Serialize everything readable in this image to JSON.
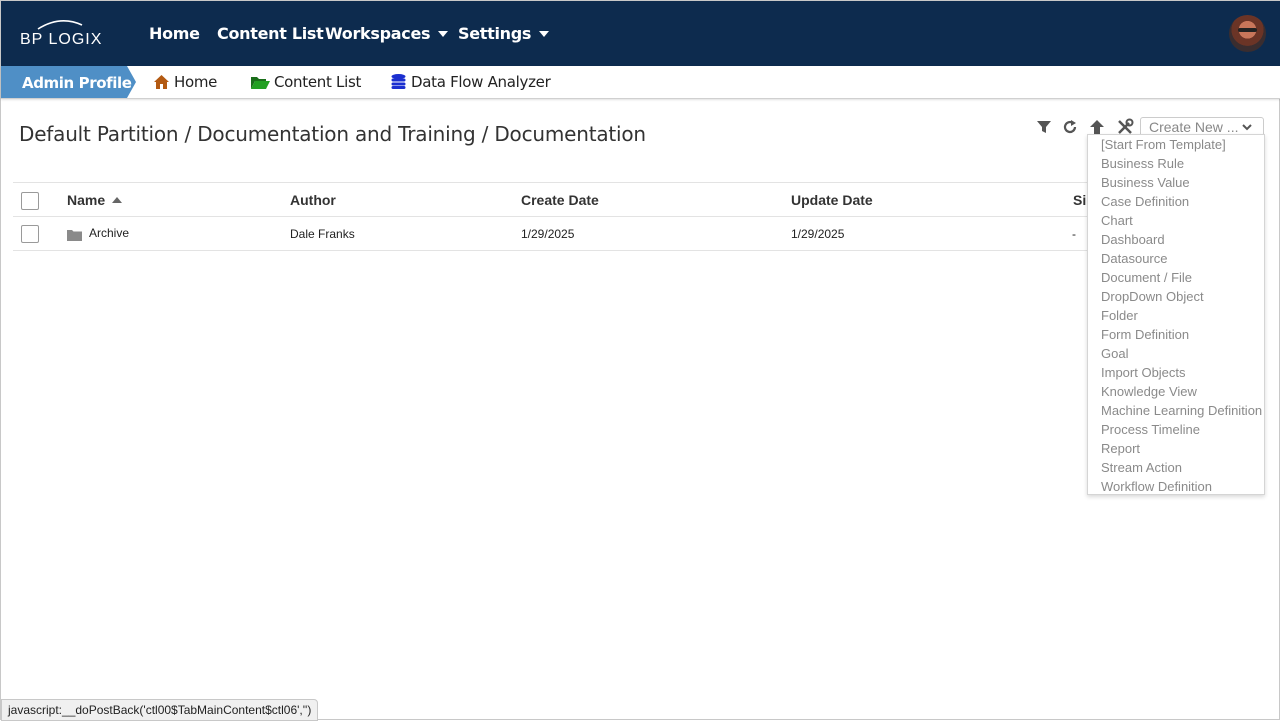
{
  "brand": {
    "logo_text": "BP LOGIX"
  },
  "topnav": {
    "items": [
      {
        "label": "Home",
        "has_caret": false
      },
      {
        "label": "Content List",
        "has_caret": false
      },
      {
        "label": "Workspaces",
        "has_caret": true
      },
      {
        "label": "Settings",
        "has_caret": true
      }
    ],
    "avatar": "user-avatar"
  },
  "tabbar": {
    "profile": "Admin Profile",
    "tabs": [
      {
        "label": "Home",
        "icon": "home-icon",
        "color": "#b35a12"
      },
      {
        "label": "Content List",
        "icon": "folder-open-icon",
        "color": "#1a8a1a"
      },
      {
        "label": "Data Flow Analyzer",
        "icon": "database-icon",
        "color": "#1b2fd0"
      }
    ]
  },
  "path": "Default Partition / Documentation and Training / Documentation",
  "toolbar": {
    "icons": [
      "filter-icon",
      "refresh-icon",
      "up-arrow-icon",
      "tools-icon"
    ],
    "create_new_label": "Create New ..."
  },
  "table": {
    "columns": [
      "Name",
      "Author",
      "Create Date",
      "Update Date",
      "Si"
    ],
    "rows": [
      {
        "name": "Archive",
        "author": "Dale Franks",
        "create_date": "1/29/2025",
        "update_date": "1/29/2025",
        "size": "-"
      }
    ]
  },
  "create_menu": [
    "[Start From Template]",
    "Business Rule",
    "Business Value",
    "Case Definition",
    "Chart",
    "Dashboard",
    "Datasource",
    "Document / File",
    "DropDown Object",
    "Folder",
    "Form Definition",
    "Goal",
    "Import Objects",
    "Knowledge View",
    "Machine Learning Definition",
    "Process Timeline",
    "Report",
    "Stream Action",
    "Workflow Definition"
  ],
  "status_bar": "javascript:__doPostBack('ctl00$TabMainContent$ctl06','')",
  "colors": {
    "nav_bg": "#0d2b4e",
    "profile_bg": "#4f8fc6",
    "menu_text": "#8a8a8a"
  }
}
